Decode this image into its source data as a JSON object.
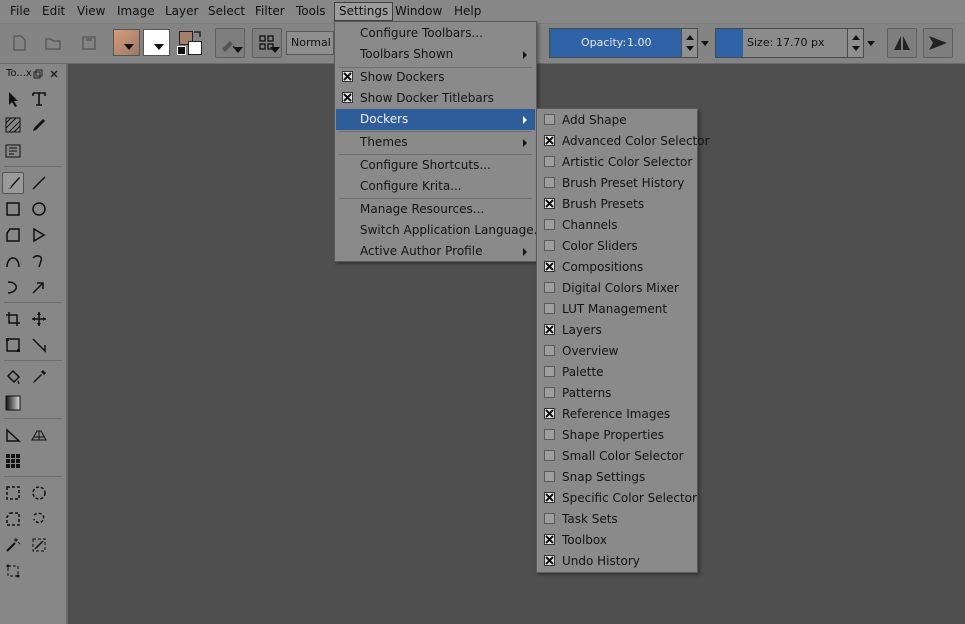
{
  "menubar": {
    "items": [
      "File",
      "Edit",
      "View",
      "Image",
      "Layer",
      "Select",
      "Filter",
      "Tools",
      "Settings",
      "Window",
      "Help"
    ],
    "active": "Settings"
  },
  "toolbar": {
    "blend_mode": "Normal",
    "opacity_label": "Opacity:",
    "opacity_value": "1.00",
    "opacity_fraction": 1.0,
    "size_label": "Size:",
    "size_value": "17.70 px",
    "size_fraction": 0.2,
    "foreground_color": "#a4806a",
    "background_color": "#ffffff",
    "accent_color": "#2f63a8"
  },
  "toolbox": {
    "title": "To...x"
  },
  "settings_menu": {
    "items": [
      {
        "label": "Configure Toolbars...",
        "submenu": false
      },
      {
        "label": "Toolbars Shown",
        "submenu": true
      },
      {
        "label": "Show Dockers",
        "checked": true
      },
      {
        "label": "Show Docker Titlebars",
        "checked": true
      },
      {
        "label": "Dockers",
        "submenu": true,
        "highlighted": true
      },
      {
        "label": "Themes",
        "submenu": true
      },
      {
        "label": "Configure Shortcuts...",
        "submenu": false
      },
      {
        "label": "Configure Krita...",
        "submenu": false
      },
      {
        "label": "Manage Resources...",
        "submenu": false
      },
      {
        "label": "Switch Application Language...",
        "submenu": false
      },
      {
        "label": "Active Author Profile",
        "submenu": true
      }
    ]
  },
  "dockers_menu": {
    "items": [
      {
        "label": "Add Shape",
        "checked": false
      },
      {
        "label": "Advanced Color Selector",
        "checked": true
      },
      {
        "label": "Artistic Color Selector",
        "checked": false
      },
      {
        "label": "Brush Preset History",
        "checked": false
      },
      {
        "label": "Brush Presets",
        "checked": true
      },
      {
        "label": "Channels",
        "checked": false
      },
      {
        "label": "Color Sliders",
        "checked": false
      },
      {
        "label": "Compositions",
        "checked": true
      },
      {
        "label": "Digital Colors Mixer",
        "checked": false
      },
      {
        "label": "LUT Management",
        "checked": false
      },
      {
        "label": "Layers",
        "checked": true
      },
      {
        "label": "Overview",
        "checked": false
      },
      {
        "label": "Palette",
        "checked": false
      },
      {
        "label": "Patterns",
        "checked": false
      },
      {
        "label": "Reference Images",
        "checked": true
      },
      {
        "label": "Shape Properties",
        "checked": false
      },
      {
        "label": "Small Color Selector",
        "checked": false
      },
      {
        "label": "Snap Settings",
        "checked": false
      },
      {
        "label": "Specific Color Selector",
        "checked": true
      },
      {
        "label": "Task Sets",
        "checked": false
      },
      {
        "label": "Toolbox",
        "checked": true
      },
      {
        "label": "Undo History",
        "checked": true
      }
    ]
  }
}
